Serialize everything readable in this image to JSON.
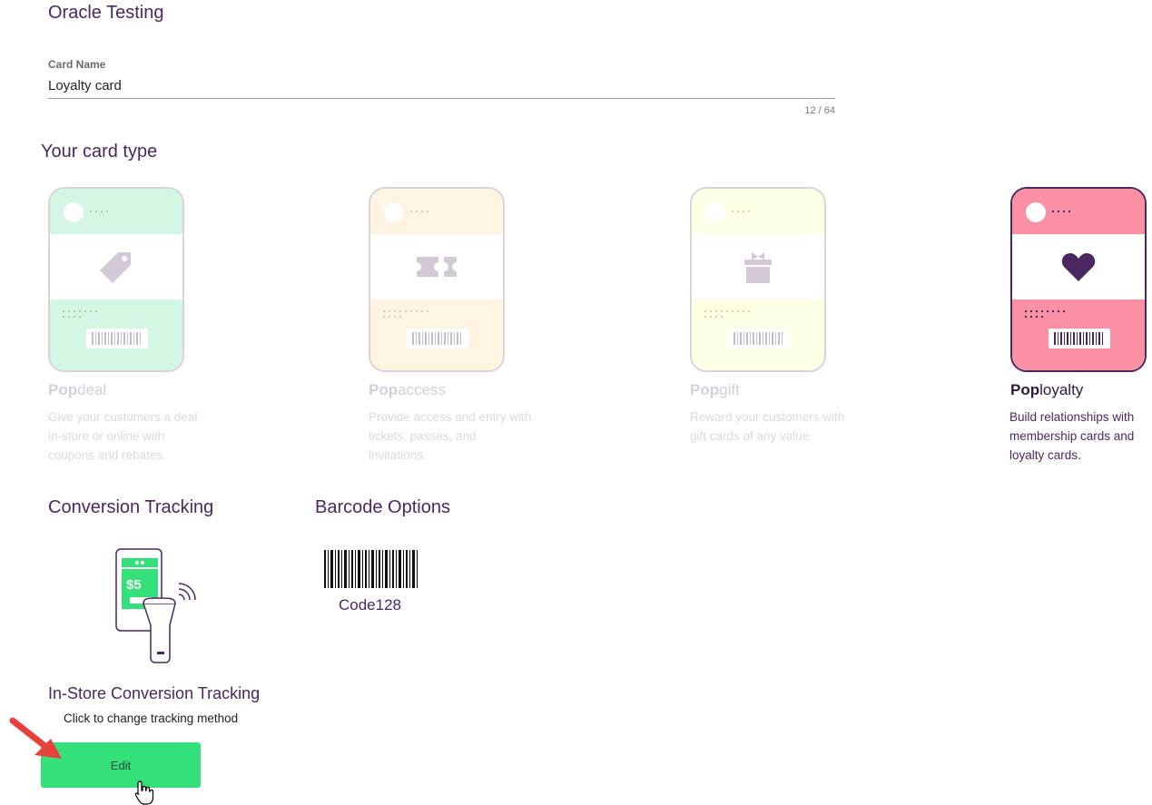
{
  "header": {
    "title": "Oracle Testing"
  },
  "card_name_field": {
    "label": "Card Name",
    "value": "Loyalty card",
    "counter": "12 / 64"
  },
  "card_type_section": {
    "title": "Your card type",
    "cards": [
      {
        "brand": "Pop",
        "suffix": "deal",
        "description": "Give your customers a deal in-store or online with coupons and rebates.",
        "icon": "tag-icon",
        "color": "#d3f7e3",
        "selected": false
      },
      {
        "brand": "Pop",
        "suffix": "access",
        "description": "Provide access and entry with tickets, passes, and invitations.",
        "icon": "ticket-icon",
        "color": "#fff4e1",
        "selected": false
      },
      {
        "brand": "Pop",
        "suffix": "gift",
        "description": "Reward your customers with gift cards of any value.",
        "icon": "gift-icon",
        "color": "#ffffe6",
        "selected": false
      },
      {
        "brand": "Pop",
        "suffix": "loyalty",
        "description": "Build relationships with membership cards and loyalty cards.",
        "icon": "heart-icon",
        "color": "#fb8fa4",
        "selected": true
      }
    ]
  },
  "conversion_tracking": {
    "title": "Conversion Tracking",
    "method": "In-Store Conversion Tracking",
    "hint": "Click to change tracking method",
    "illustration_icon": "phone-scanner-icon",
    "illustration_price": "$5",
    "edit_label": "Edit"
  },
  "barcode_options": {
    "title": "Barcode Options",
    "icon": "barcode-icon",
    "selected": "Code128"
  },
  "colors": {
    "accent_purple": "#4a2760",
    "edit_green": "#33e07a",
    "arrow_red": "#e8413c"
  }
}
